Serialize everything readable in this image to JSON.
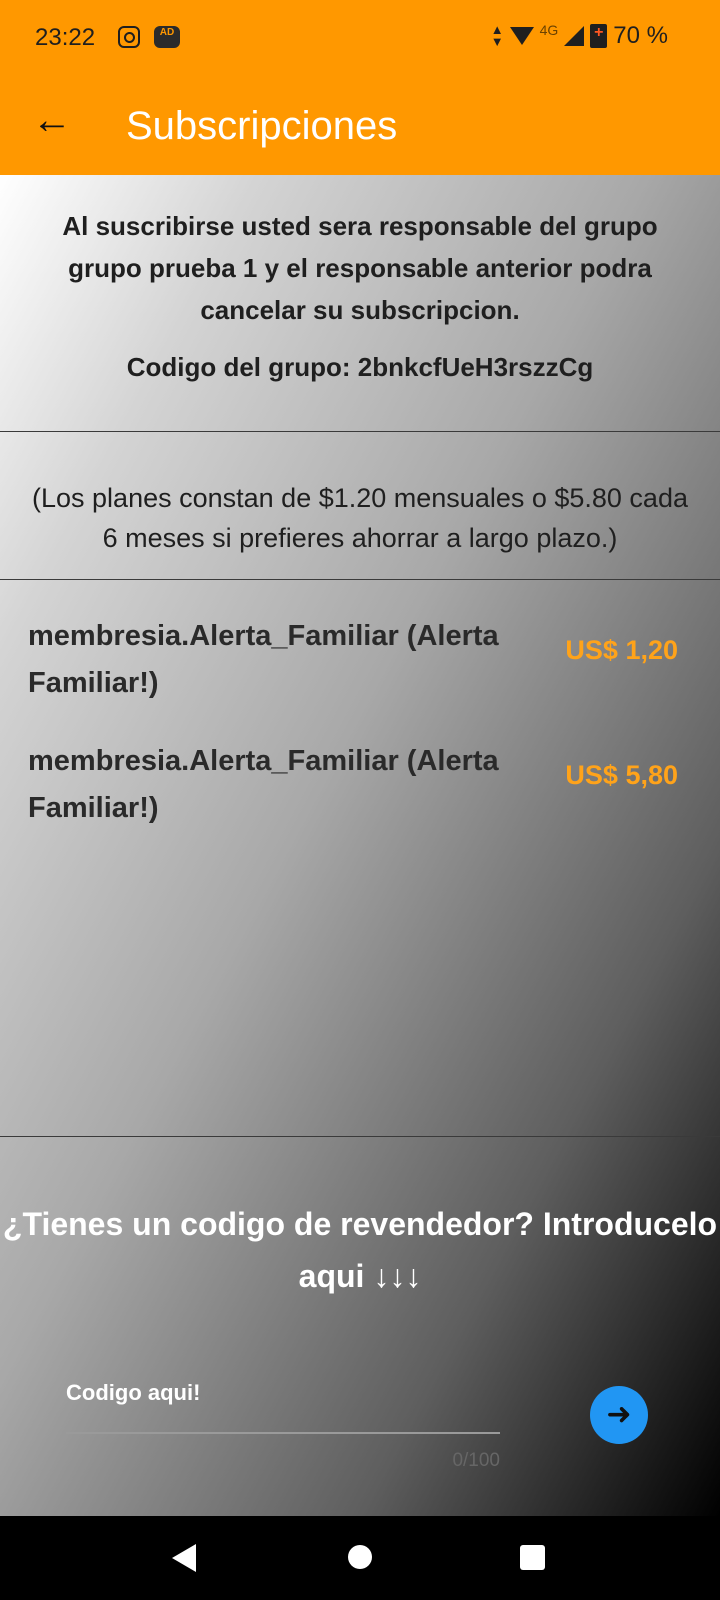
{
  "status_bar": {
    "time": "23:22",
    "network": "4G",
    "battery": "70 %",
    "icons": [
      "instagram-icon",
      "adblock-icon",
      "data-arrows-icon",
      "wifi-icon",
      "signal-icon",
      "battery-charging-icon"
    ]
  },
  "app_bar": {
    "title": "Subscripciones",
    "back_icon": "arrow-left-icon",
    "background_color": "#ff9800"
  },
  "intro": {
    "text": "Al suscribirse usted sera responsable del grupo grupo prueba 1 y el responsable anterior podra cancelar su subscripcion.",
    "group_code": "Codigo del grupo: 2bnkcfUeH3rszzCg"
  },
  "plans_note": "(Los planes constan de $1.20 mensuales o $5.80 cada 6 meses si prefieres ahorrar a largo plazo.)",
  "plans": [
    {
      "name": "membresia.Alerta_Familiar (Alerta Familiar!)",
      "price": "US$ 1,20"
    },
    {
      "name": "membresia.Alerta_Familiar (Alerta Familiar!)",
      "price": "US$ 5,80"
    }
  ],
  "reseller": {
    "title": "¿Tienes un codigo de revendedor? Introducelo aqui ↓↓↓",
    "placeholder": "Codigo aqui!",
    "counter": "0/100",
    "submit_icon": "arrow-right-icon",
    "submit_color": "#2196f3"
  },
  "price_color": "#ffa31a",
  "nav_bar": {
    "icons": [
      "nav-back-icon",
      "nav-home-icon",
      "nav-recents-icon"
    ]
  }
}
